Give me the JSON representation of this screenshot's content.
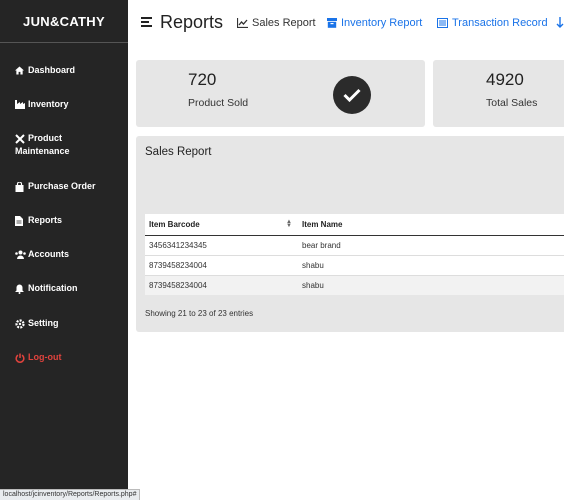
{
  "brand": "JUN&CATHY",
  "sidebar": {
    "items": [
      {
        "label": "Dashboard",
        "icon": "home-icon"
      },
      {
        "label": "Inventory",
        "icon": "industry-icon"
      },
      {
        "label": "Product Maintenance",
        "line1": "Product",
        "line2": "Maintenance",
        "icon": "tools-icon"
      },
      {
        "label": "Purchase Order",
        "icon": "shopping-bag-icon"
      },
      {
        "label": "Reports",
        "icon": "file-icon"
      },
      {
        "label": "Accounts",
        "icon": "users-icon"
      },
      {
        "label": "Notification",
        "icon": "bell-icon"
      },
      {
        "label": "Setting",
        "icon": "gear-icon"
      },
      {
        "label": "Log-out",
        "icon": "power-icon",
        "color": "#e0433d"
      }
    ]
  },
  "header": {
    "title": "Reports",
    "links": [
      {
        "label": "Sales Report",
        "icon": "line-chart-icon"
      },
      {
        "label": "Inventory Report",
        "icon": "box-icon"
      },
      {
        "label": "Transaction Record",
        "icon": "list-icon"
      }
    ]
  },
  "cards": [
    {
      "value": "720",
      "label": "Product Sold",
      "icon": "check-circle-icon"
    },
    {
      "value": "4920",
      "label": "Total Sales"
    }
  ],
  "report": {
    "title": "Sales Report",
    "columns": [
      "Item Barcode",
      "Item Name"
    ],
    "rows": [
      {
        "barcode": "3456341234345",
        "name": "bear brand"
      },
      {
        "barcode": "8739458234004",
        "name": "shabu"
      },
      {
        "barcode": "8739458234004",
        "name": "shabu"
      }
    ],
    "info": "Showing 21 to 23 of 23 entries"
  },
  "statusbar": "localhost/jcinventory/Reports/Reports.php#",
  "colors": {
    "sidebar": "#252525",
    "accent": "#1a73e8",
    "logout": "#e0433d",
    "card": "#e6e6e6"
  }
}
